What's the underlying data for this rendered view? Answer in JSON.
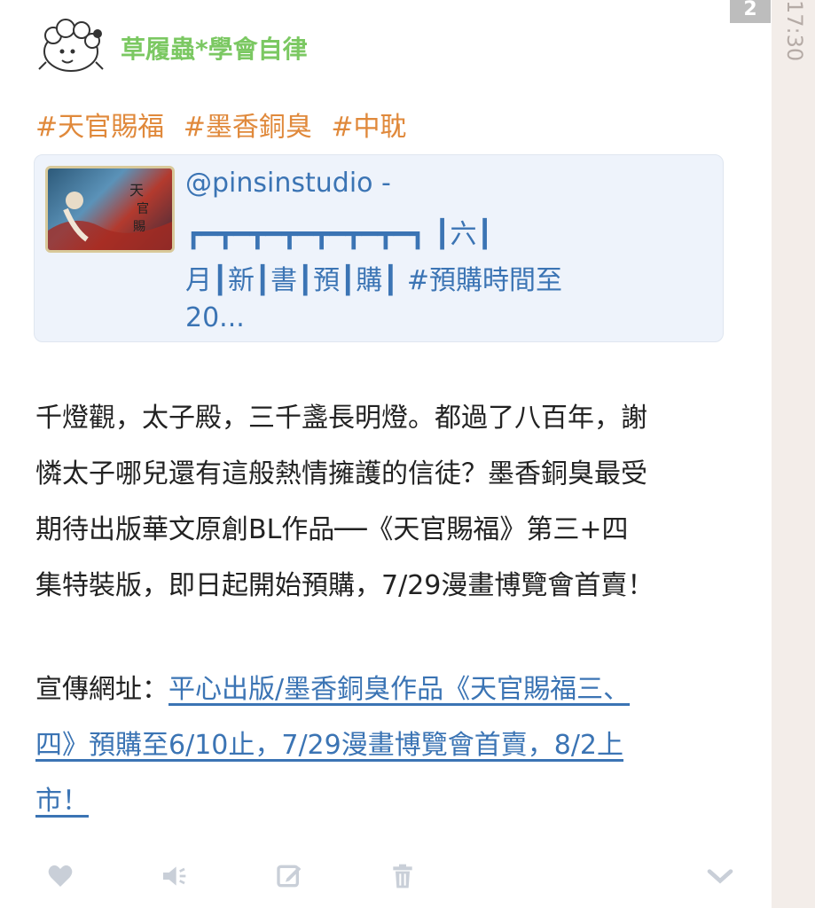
{
  "post": {
    "username": "草履蟲*學會自律",
    "tags": [
      "#天官賜福",
      "#墨香銅臭",
      "#中耽"
    ],
    "preview": {
      "line1": "@pinsinstudio -",
      "line2": "┏━┳━┳━┳━┳━┳━┳━┓ ┃六┃",
      "line3": "月┃新┃書┃預┃購┃ #預購時間至",
      "line4": "20..."
    },
    "body": {
      "p1": "千燈觀，太子殿，三千盞長明燈。都過了八百年，謝",
      "p2": "憐太子哪兒還有這般熱情擁護的信徒？墨香銅臭最受",
      "p3": "期待出版華文原創BL作品──《天官賜福》第三+四",
      "p4": "集特裝版，即日起開始預購，7/29漫畫博覽會首賣！",
      "link_label": "宣傳網址：",
      "link1": "平心出版/墨香銅臭作品《天官賜福三、",
      "link2": "四》預購至6/10止，7/29漫畫博覽會首賣，8/2上",
      "link3": "市！"
    }
  },
  "side": {
    "page_badge": "2",
    "time": "17:30"
  },
  "actions": {
    "icons": [
      "heart-icon",
      "speaker-icon",
      "edit-icon",
      "trash-icon",
      "chevron-down-icon"
    ]
  },
  "colors": {
    "username": "#7bc862",
    "tags": "#e0893b",
    "link": "#3b74b4",
    "icons": "#c9cfd8"
  }
}
